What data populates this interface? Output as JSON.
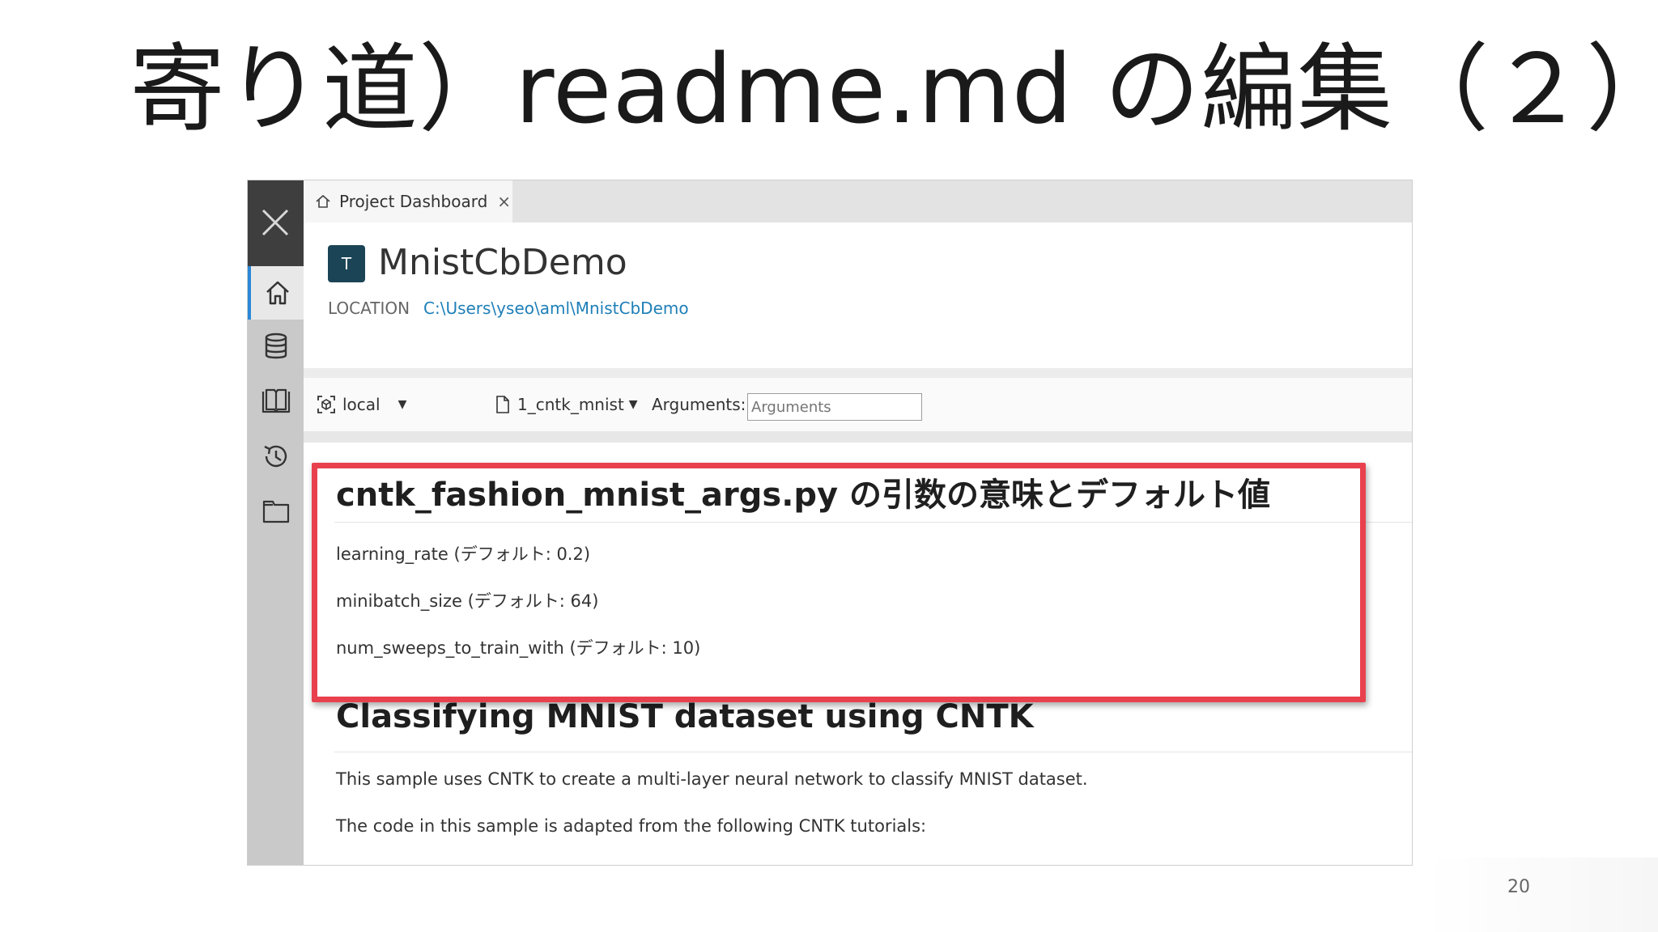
{
  "slide": {
    "title": "寄り道）readme.md の編集（２）",
    "page_number": "20"
  },
  "app": {
    "sidebar": {
      "items": [
        {
          "icon": "close-icon"
        },
        {
          "icon": "home-icon",
          "active": true
        },
        {
          "icon": "database-icon"
        },
        {
          "icon": "book-icon"
        },
        {
          "icon": "history-icon"
        },
        {
          "icon": "folder-icon"
        }
      ]
    },
    "tab": {
      "label": "Project Dashboard",
      "close": "×"
    },
    "project": {
      "badge": "T",
      "name": "MnistCbDemo",
      "location_label": "LOCATION",
      "location_value": "C:\\Users\\yseo\\aml\\MnistCbDemo"
    },
    "toolbar": {
      "target": "local",
      "script": "1_cntk_mnist",
      "arguments_label": "Arguments:",
      "arguments_placeholder": "Arguments"
    },
    "readme": {
      "heading1": "cntk_fashion_mnist_args.py の引数の意味とデフォルト値",
      "params": [
        "learning_rate (デフォルト: 0.2)",
        "minibatch_size (デフォルト: 64)",
        "num_sweeps_to_train_with (デフォルト: 10)"
      ],
      "heading2": "Classifying MNIST dataset using CNTK",
      "paragraphs": [
        "This sample uses CNTK to create a multi-layer neural network to classify MNIST dataset.",
        "The code in this sample is adapted from the following CNTK tutorials:"
      ]
    },
    "colors": {
      "highlight": "#e8414d",
      "link": "#1e7fb8",
      "badge": "#1b4456"
    }
  }
}
